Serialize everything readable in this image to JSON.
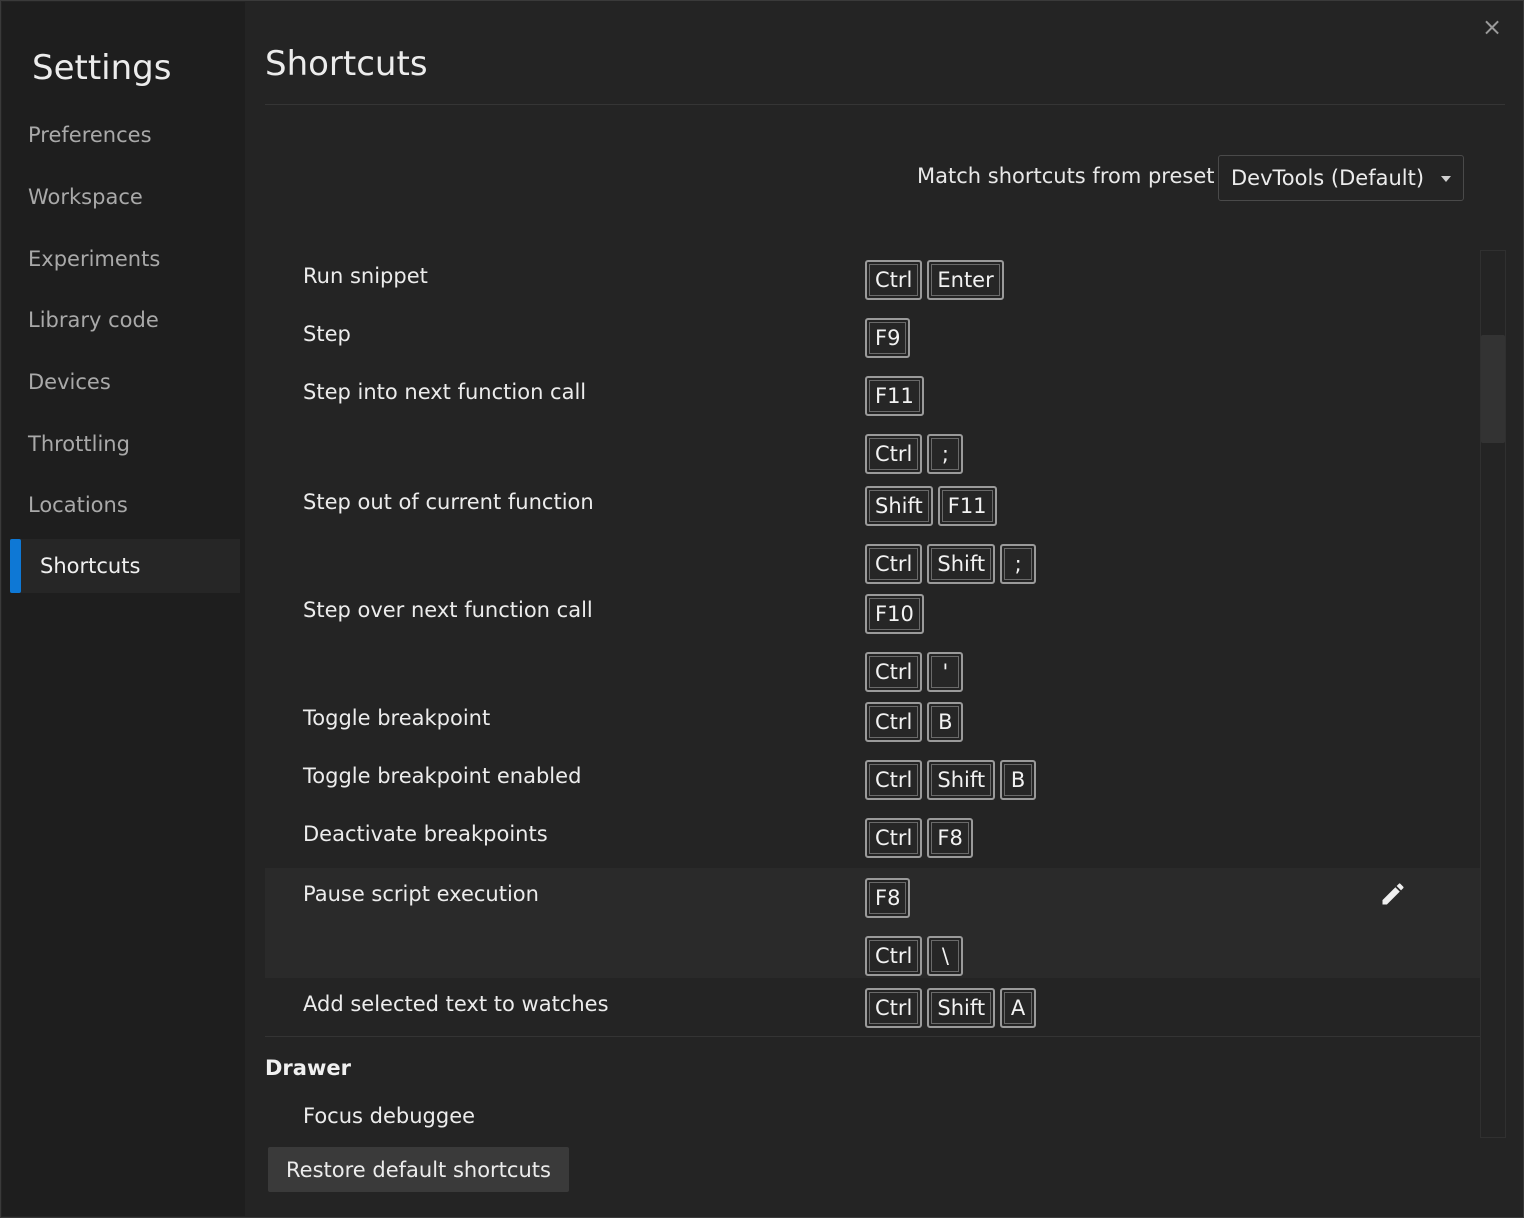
{
  "sidebar": {
    "title": "Settings",
    "items": [
      {
        "label": "Preferences"
      },
      {
        "label": "Workspace"
      },
      {
        "label": "Experiments"
      },
      {
        "label": "Library code"
      },
      {
        "label": "Devices"
      },
      {
        "label": "Throttling"
      },
      {
        "label": "Locations"
      },
      {
        "label": "Shortcuts",
        "active": true
      }
    ]
  },
  "main": {
    "title": "Shortcuts",
    "close_icon": "close-icon",
    "preset": {
      "label": "Match shortcuts from preset",
      "selected": "DevTools (Default)"
    },
    "shortcuts": [
      {
        "label": "Run snippet",
        "keys": [
          [
            "Ctrl",
            "Enter"
          ]
        ]
      },
      {
        "label": "Step",
        "keys": [
          [
            "F9"
          ]
        ]
      },
      {
        "label": "Step into next function call",
        "keys": [
          [
            "F11"
          ],
          [
            "Ctrl",
            ";"
          ]
        ]
      },
      {
        "label": "Step out of current function",
        "keys": [
          [
            "Shift",
            "F11"
          ],
          [
            "Ctrl",
            "Shift",
            ";"
          ]
        ]
      },
      {
        "label": "Step over next function call",
        "keys": [
          [
            "F10"
          ],
          [
            "Ctrl",
            "'"
          ]
        ]
      },
      {
        "label": "Toggle breakpoint",
        "keys": [
          [
            "Ctrl",
            "B"
          ]
        ]
      },
      {
        "label": "Toggle breakpoint enabled",
        "keys": [
          [
            "Ctrl",
            "Shift",
            "B"
          ]
        ]
      },
      {
        "label": "Deactivate breakpoints",
        "keys": [
          [
            "Ctrl",
            "F8"
          ]
        ]
      },
      {
        "label": "Pause script execution",
        "keys": [
          [
            "F8"
          ],
          [
            "Ctrl",
            "\\"
          ]
        ],
        "hovered": true,
        "edit_icon": "pencil-icon"
      },
      {
        "label": "Add selected text to watches",
        "keys": [
          [
            "Ctrl",
            "Shift",
            "A"
          ]
        ]
      }
    ],
    "section": {
      "title": "Drawer",
      "items": [
        {
          "label": "Focus debuggee"
        }
      ]
    },
    "restore_label": "Restore default shortcuts"
  },
  "colors": {
    "accent": "#0e78d5",
    "background": "#242424",
    "sidebar_background": "#1e1e1e"
  }
}
